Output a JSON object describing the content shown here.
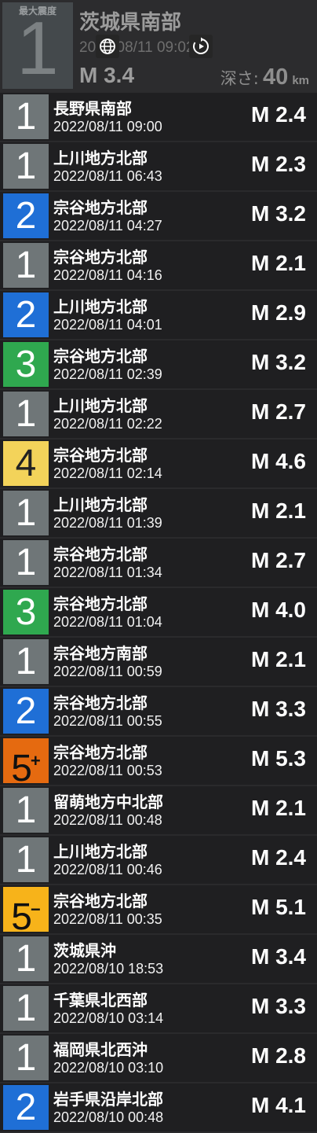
{
  "colors": {
    "intensity_1": "#6f7678",
    "intensity_2": "#1f6fd6",
    "intensity_3": "#2fa84f",
    "intensity_4": "#f3d35a",
    "intensity_5plus": "#e56a10",
    "intensity_5minus": "#f7b31a"
  },
  "header": {
    "badge_label": "最大震度",
    "intensity": "1",
    "region": "茨城県南部",
    "datetime": "2022/08/11  09:02",
    "magnitude": "M 3.4",
    "depth_label": "深さ:",
    "depth_value": "40",
    "depth_unit": "km",
    "globe_icon": "globe-icon",
    "play_icon": "replay-icon"
  },
  "quakes": [
    {
      "intensity": "1",
      "sup": "",
      "color": "#6f7678",
      "text_color": "#ffffff",
      "region": "長野県南部",
      "datetime": "2022/08/11  09:00",
      "magnitude": "M 2.4"
    },
    {
      "intensity": "1",
      "sup": "",
      "color": "#6f7678",
      "text_color": "#ffffff",
      "region": "上川地方北部",
      "datetime": "2022/08/11  06:43",
      "magnitude": "M 2.3"
    },
    {
      "intensity": "2",
      "sup": "",
      "color": "#1f6fd6",
      "text_color": "#ffffff",
      "region": "宗谷地方北部",
      "datetime": "2022/08/11  04:27",
      "magnitude": "M 3.2"
    },
    {
      "intensity": "1",
      "sup": "",
      "color": "#6f7678",
      "text_color": "#ffffff",
      "region": "宗谷地方北部",
      "datetime": "2022/08/11  04:16",
      "magnitude": "M 2.1"
    },
    {
      "intensity": "2",
      "sup": "",
      "color": "#1f6fd6",
      "text_color": "#ffffff",
      "region": "上川地方北部",
      "datetime": "2022/08/11  04:01",
      "magnitude": "M 2.9"
    },
    {
      "intensity": "3",
      "sup": "",
      "color": "#2fa84f",
      "text_color": "#ffffff",
      "region": "宗谷地方北部",
      "datetime": "2022/08/11  02:39",
      "magnitude": "M 3.2"
    },
    {
      "intensity": "1",
      "sup": "",
      "color": "#6f7678",
      "text_color": "#ffffff",
      "region": "上川地方北部",
      "datetime": "2022/08/11  02:22",
      "magnitude": "M 2.7"
    },
    {
      "intensity": "4",
      "sup": "",
      "color": "#f3d35a",
      "text_color": "#222222",
      "region": "宗谷地方北部",
      "datetime": "2022/08/11  02:14",
      "magnitude": "M 4.6"
    },
    {
      "intensity": "1",
      "sup": "",
      "color": "#6f7678",
      "text_color": "#ffffff",
      "region": "上川地方北部",
      "datetime": "2022/08/11  01:39",
      "magnitude": "M 2.1"
    },
    {
      "intensity": "1",
      "sup": "",
      "color": "#6f7678",
      "text_color": "#ffffff",
      "region": "宗谷地方北部",
      "datetime": "2022/08/11  01:34",
      "magnitude": "M 2.7"
    },
    {
      "intensity": "3",
      "sup": "",
      "color": "#2fa84f",
      "text_color": "#ffffff",
      "region": "宗谷地方北部",
      "datetime": "2022/08/11  01:04",
      "magnitude": "M 4.0"
    },
    {
      "intensity": "1",
      "sup": "",
      "color": "#6f7678",
      "text_color": "#ffffff",
      "region": "宗谷地方南部",
      "datetime": "2022/08/11  00:59",
      "magnitude": "M 2.1"
    },
    {
      "intensity": "2",
      "sup": "",
      "color": "#1f6fd6",
      "text_color": "#ffffff",
      "region": "宗谷地方北部",
      "datetime": "2022/08/11  00:55",
      "magnitude": "M 3.3"
    },
    {
      "intensity": "5",
      "sup": "+",
      "color": "#e56a10",
      "text_color": "#111111",
      "region": "宗谷地方北部",
      "datetime": "2022/08/11  00:53",
      "magnitude": "M 5.3"
    },
    {
      "intensity": "1",
      "sup": "",
      "color": "#6f7678",
      "text_color": "#ffffff",
      "region": "留萌地方中北部",
      "datetime": "2022/08/11  00:48",
      "magnitude": "M 2.1"
    },
    {
      "intensity": "1",
      "sup": "",
      "color": "#6f7678",
      "text_color": "#ffffff",
      "region": "上川地方北部",
      "datetime": "2022/08/11  00:46",
      "magnitude": "M 2.4"
    },
    {
      "intensity": "5",
      "sup": "−",
      "color": "#f7b31a",
      "text_color": "#111111",
      "region": "宗谷地方北部",
      "datetime": "2022/08/11  00:35",
      "magnitude": "M 5.1"
    },
    {
      "intensity": "1",
      "sup": "",
      "color": "#6f7678",
      "text_color": "#ffffff",
      "region": "茨城県沖",
      "datetime": "2022/08/10  18:53",
      "magnitude": "M 3.4"
    },
    {
      "intensity": "1",
      "sup": "",
      "color": "#6f7678",
      "text_color": "#ffffff",
      "region": "千葉県北西部",
      "datetime": "2022/08/10  03:14",
      "magnitude": "M 3.3"
    },
    {
      "intensity": "1",
      "sup": "",
      "color": "#6f7678",
      "text_color": "#ffffff",
      "region": "福岡県北西沖",
      "datetime": "2022/08/10  03:10",
      "magnitude": "M 2.8"
    },
    {
      "intensity": "2",
      "sup": "",
      "color": "#1f6fd6",
      "text_color": "#ffffff",
      "region": "岩手県沿岸北部",
      "datetime": "2022/08/10  00:48",
      "magnitude": "M 4.1"
    }
  ]
}
